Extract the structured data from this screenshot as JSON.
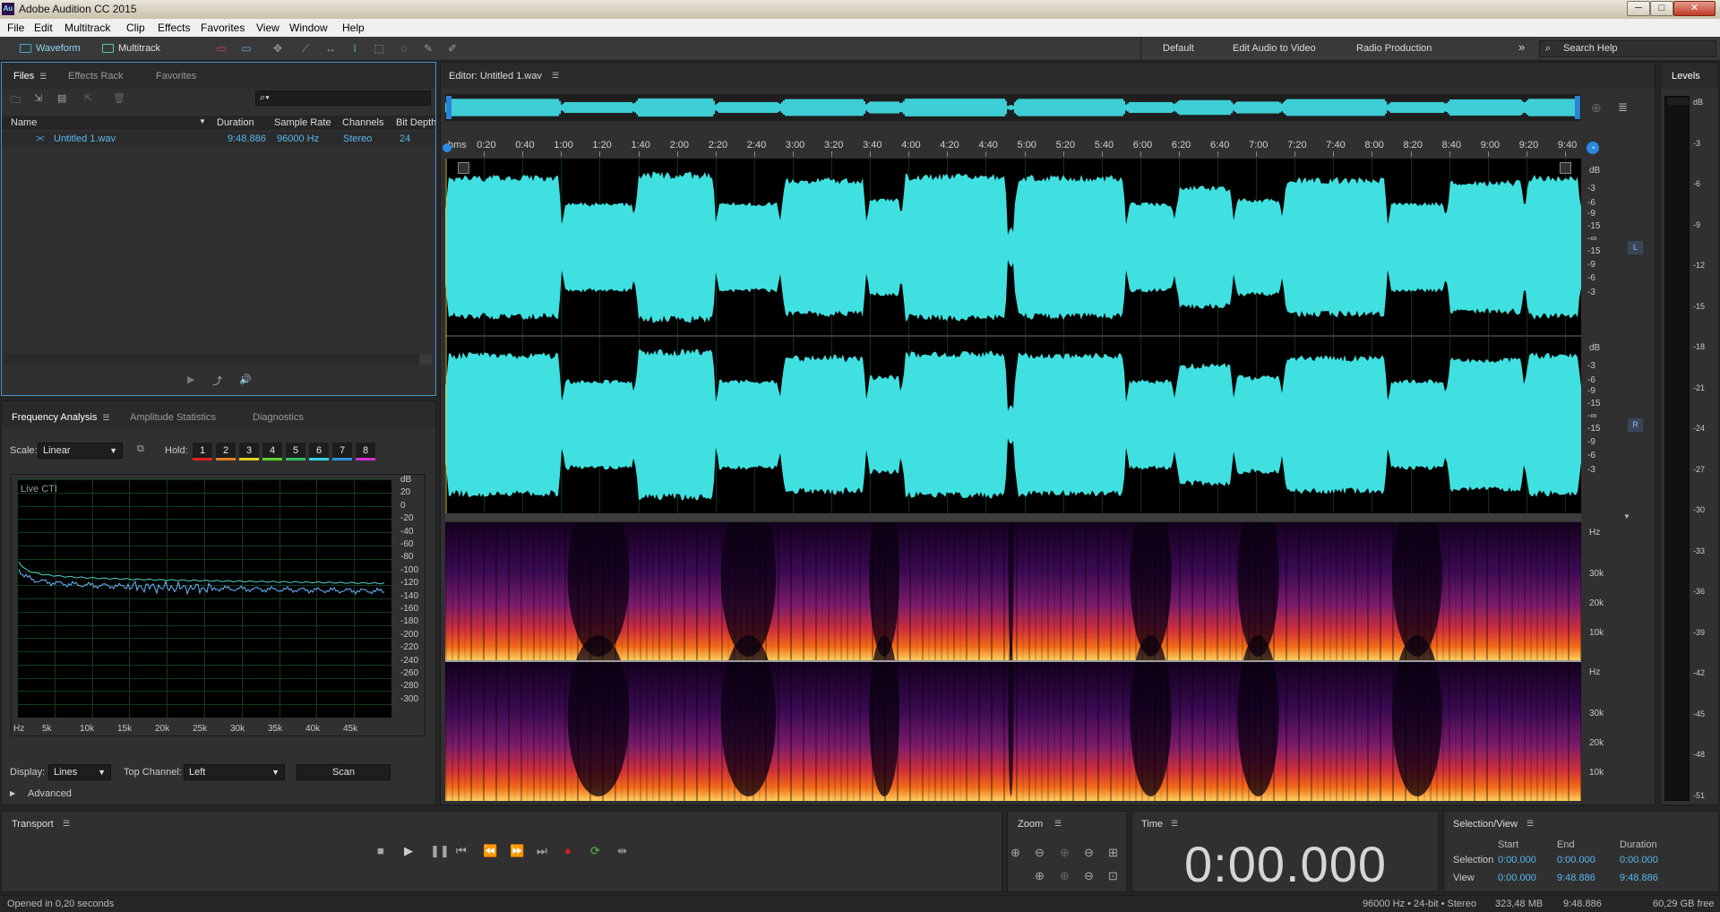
{
  "window": {
    "title": "Adobe Audition CC 2015",
    "app_icon": "Au",
    "minimize": "─",
    "maximize": "□",
    "close": "✕"
  },
  "menu": [
    "File",
    "Edit",
    "Multitrack",
    "Clip",
    "Effects",
    "Favorites",
    "View",
    "Window",
    "Help"
  ],
  "toolbar": {
    "waveform_label": "Waveform",
    "multitrack_label": "Multitrack",
    "workspaces": [
      "Default",
      "Edit Audio to Video",
      "Radio Production"
    ],
    "more": "»",
    "search_placeholder": "Search Help"
  },
  "files_panel": {
    "tabs": [
      "Files",
      "Effects Rack",
      "Favorites"
    ],
    "columns": [
      "Name",
      "Duration",
      "Sample Rate",
      "Channels",
      "Bit Depth"
    ],
    "rows": [
      {
        "name": "Untitled 1.wav",
        "duration": "9:48.886",
        "sample_rate": "96000 Hz",
        "channels": "Stereo",
        "bit_depth": "24"
      }
    ]
  },
  "analysis_panel": {
    "tabs": [
      "Frequency Analysis",
      "Amplitude Statistics",
      "Diagnostics"
    ],
    "scale_label": "Scale:",
    "scale_value": "Linear",
    "hold_label": "Hold:",
    "hold_buttons": [
      "1",
      "2",
      "3",
      "4",
      "5",
      "6",
      "7",
      "8"
    ],
    "hold_colors": [
      "#e02020",
      "#e08020",
      "#e0d020",
      "#60d030",
      "#30c060",
      "#30d0e0",
      "#3090e0",
      "#d030d0"
    ],
    "graph_label": "Live CTI",
    "db_ticks": [
      "dB",
      "20",
      "0",
      "-20",
      "-40",
      "-60",
      "-80",
      "-100",
      "-120",
      "-140",
      "-160",
      "-180",
      "-200",
      "-220",
      "-240",
      "-260",
      "-280",
      "-300"
    ],
    "hz_ticks": [
      "Hz",
      "5k",
      "10k",
      "15k",
      "20k",
      "25k",
      "30k",
      "35k",
      "40k",
      "45k"
    ],
    "display_label": "Display:",
    "display_value": "Lines",
    "top_channel_label": "Top Channel:",
    "top_channel_value": "Left",
    "scan_label": "Scan",
    "advanced_label": "Advanced"
  },
  "editor": {
    "title": "Editor: Untitled 1.wav",
    "ruler": [
      "hms",
      "0:20",
      "0:40",
      "1:00",
      "1:20",
      "1:40",
      "2:00",
      "2:20",
      "2:40",
      "3:00",
      "3:20",
      "3:40",
      "4:00",
      "4:20",
      "4:40",
      "5:00",
      "5:20",
      "5:40",
      "6:00",
      "6:20",
      "6:40",
      "7:00",
      "7:20",
      "7:40",
      "8:00",
      "8:20",
      "8:40",
      "9:00",
      "9:20",
      "9:40"
    ],
    "db_ticks_top": [
      "dB",
      "-3",
      "-6",
      "-9",
      "-15",
      "-∞",
      "-15",
      "-9",
      "-6",
      "-3"
    ],
    "db_ticks_bottom": [
      "dB",
      "-3",
      "-6",
      "-9",
      "-15",
      "-∞",
      "-15",
      "-9",
      "-6",
      "-3"
    ],
    "left_channel": "L",
    "right_channel": "R",
    "spectral_ticks": [
      "Hz",
      "30k",
      "20k",
      "10k"
    ],
    "waveform_color": "#40e0e0"
  },
  "levels": {
    "title": "Levels",
    "ticks": [
      "dB",
      "-3",
      "-6",
      "-9",
      "-12",
      "-15",
      "-18",
      "-21",
      "-24",
      "-27",
      "-30",
      "-33",
      "-36",
      "-39",
      "-42",
      "-45",
      "-48",
      "-51"
    ]
  },
  "transport": {
    "title": "Transport"
  },
  "zoom": {
    "title": "Zoom"
  },
  "time": {
    "title": "Time",
    "value": "0:00.000"
  },
  "selection_view": {
    "title": "Selection/View",
    "headers": [
      "Start",
      "End",
      "Duration"
    ],
    "rows": [
      {
        "label": "Selection",
        "start": "0:00.000",
        "end": "0:00.000",
        "duration": "0:00.000"
      },
      {
        "label": "View",
        "start": "0:00.000",
        "end": "9:48.886",
        "duration": "9:48.886"
      }
    ]
  },
  "status": {
    "left": "Opened in 0,20 seconds",
    "format": "96000 Hz • 24-bit • Stereo",
    "size": "323,48 MB",
    "duration": "9:48.886",
    "free": "60,29 GB free"
  }
}
